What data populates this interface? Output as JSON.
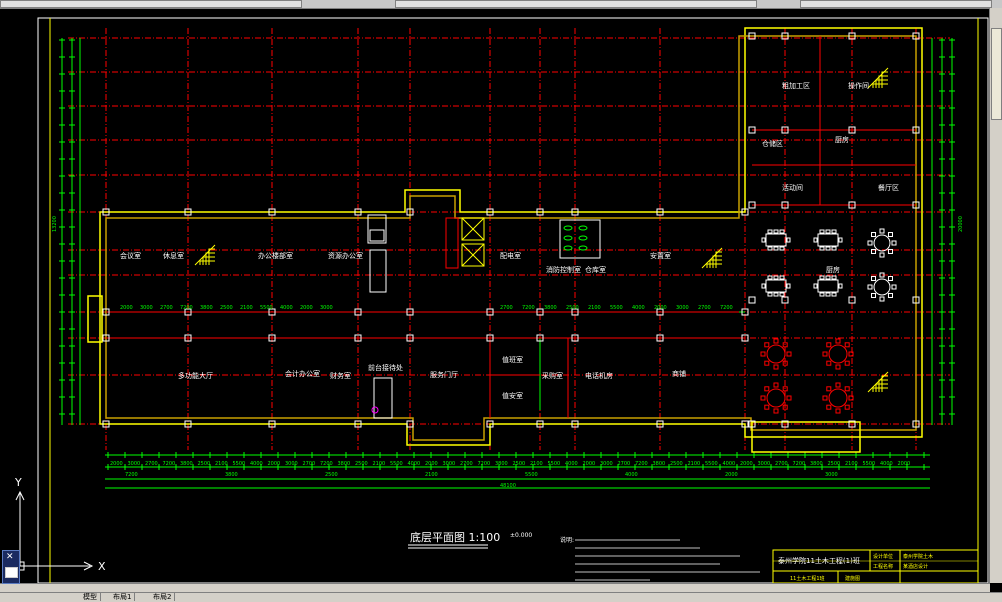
{
  "drawing": {
    "title": "底层平面图 1:100",
    "elevation": "±0.000",
    "notes_title": "说明:",
    "overall_dim": "48100",
    "left_dim": "13200",
    "right_dim": "20000"
  },
  "rooms": {
    "left": [
      "会议室",
      "休息室",
      "办公楼部室",
      "资源办公室",
      "多功能大厅",
      "会计办公室",
      "财务室",
      "前台接待处",
      "服务门厅",
      "值班室",
      "值安室",
      "采购室",
      "电话机房",
      "商铺",
      "配电室",
      "消防控制室",
      "仓库室",
      "安置室"
    ],
    "right": [
      "粗加工区",
      "操作间",
      "仓储区",
      "厨房",
      "活动间",
      "餐厅区",
      "厨房"
    ]
  },
  "axis_numbers": [
    "2000",
    "3000",
    "2700",
    "7200",
    "3800",
    "2500",
    "2100",
    "5500",
    "4000"
  ],
  "title_block": {
    "project": "泰州学院11土木工程(1)班",
    "label1": "设计单位",
    "label2": "工程名称",
    "value1": "泰州学院土木",
    "value2": "某酒店设计",
    "drawing_no": "11土木工程1班",
    "sheet": "建施图"
  },
  "ucs": {
    "x_label": "X",
    "y_label": "Y"
  },
  "tabs": [
    "模型",
    "布局1",
    "布局2"
  ],
  "colors": {
    "yellow": "#ffff00",
    "red": "#ff0000",
    "green": "#00ff00",
    "white": "#ffffff",
    "cyan": "#00ffff",
    "magenta": "#ff00ff"
  }
}
